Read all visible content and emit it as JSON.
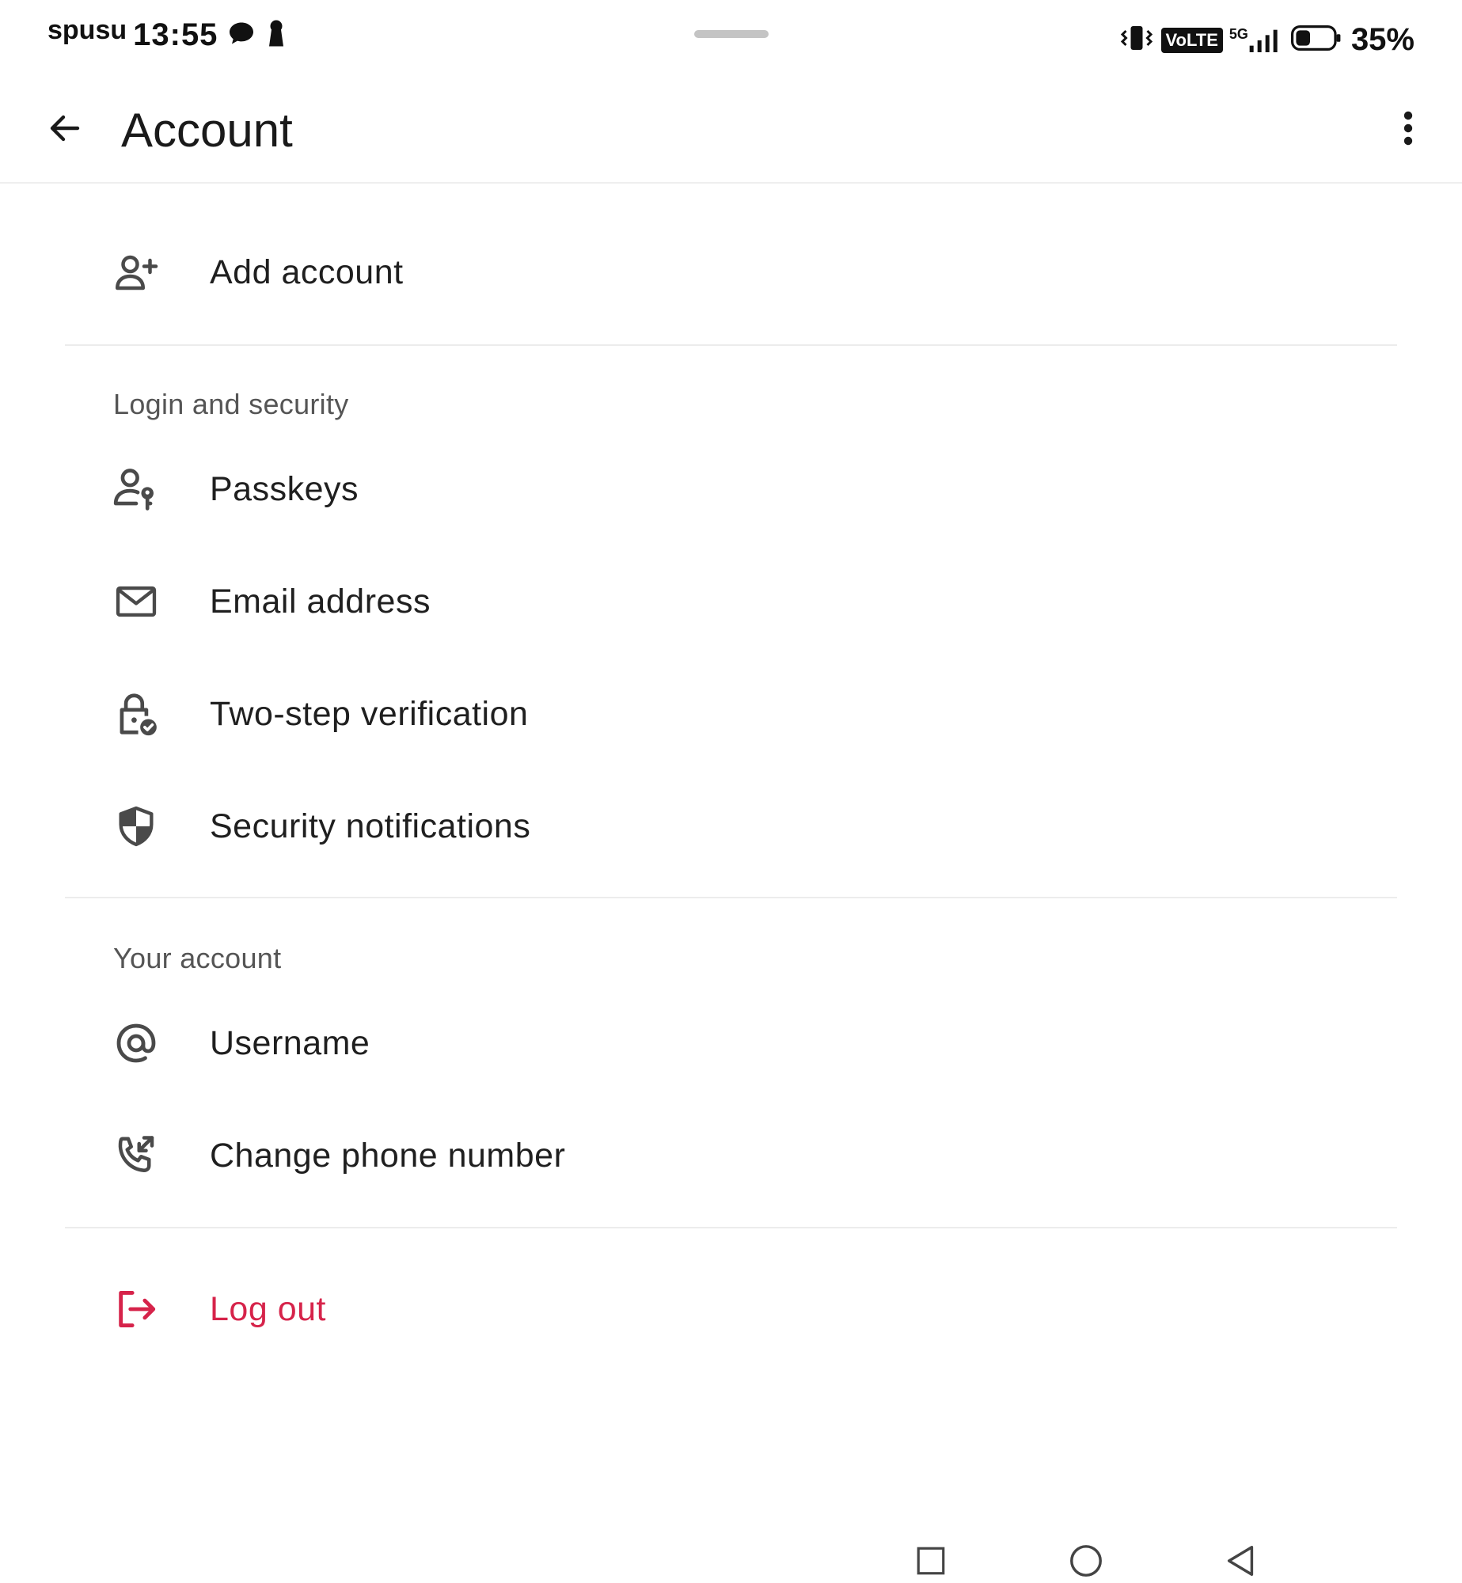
{
  "status_bar": {
    "carrier": "spusu",
    "time": "13:55",
    "volte": "VoLTE",
    "network": "5G",
    "battery_percent": "35%"
  },
  "header": {
    "title": "Account",
    "back_icon": "arrow-left-icon",
    "more_icon": "more-vertical-icon"
  },
  "add_account": {
    "label": "Add account",
    "icon": "person-add-icon"
  },
  "login_security": {
    "header": "Login and security",
    "items": [
      {
        "label": "Passkeys",
        "icon": "person-key-icon"
      },
      {
        "label": "Email address",
        "icon": "mail-icon"
      },
      {
        "label": "Two-step verification",
        "icon": "lock-check-icon"
      },
      {
        "label": "Security notifications",
        "icon": "shield-icon"
      }
    ]
  },
  "your_account": {
    "header": "Your account",
    "items": [
      {
        "label": "Username",
        "icon": "at-icon"
      },
      {
        "label": "Change phone number",
        "icon": "phone-change-icon"
      }
    ]
  },
  "logout": {
    "label": "Log out",
    "icon": "logout-icon",
    "color": "#d6234a"
  },
  "colors": {
    "accent_danger": "#d6234a",
    "icon": "#4a4a4a",
    "divider": "#ececec"
  }
}
